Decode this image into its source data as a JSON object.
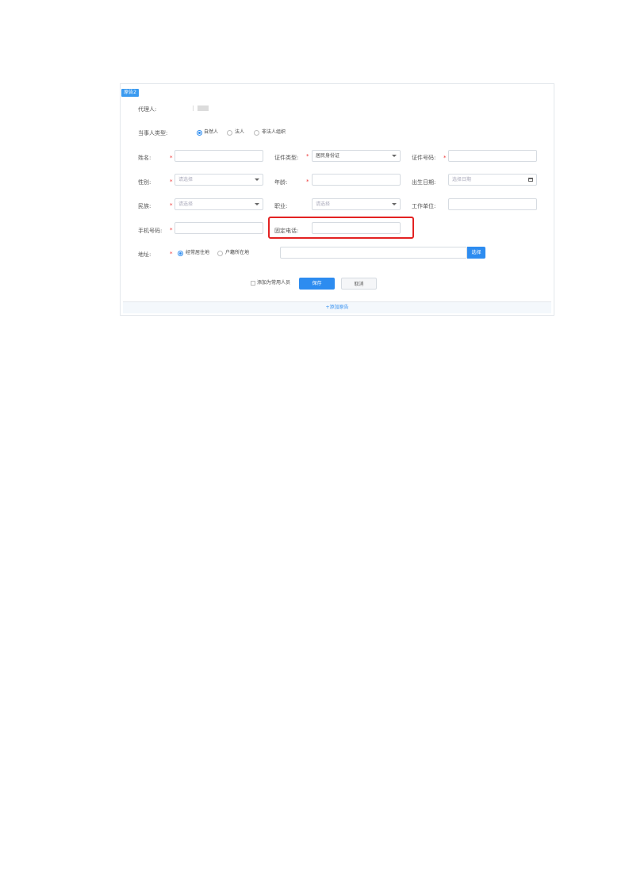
{
  "section_tag": "原告2",
  "representative": {
    "label": "代理人:"
  },
  "party_type": {
    "label": "当事人类型:",
    "options": [
      {
        "label": "自然人",
        "selected": true
      },
      {
        "label": "法人",
        "selected": false
      },
      {
        "label": "非法人组织",
        "selected": false
      }
    ]
  },
  "fields": {
    "name": {
      "label": "姓名:",
      "value": ""
    },
    "id_type": {
      "label": "证件类型:",
      "value": "居民身份证"
    },
    "id_number": {
      "label": "证件号码:",
      "value": ""
    },
    "gender": {
      "label": "性别:",
      "placeholder": "请选择"
    },
    "age": {
      "label": "年龄:",
      "value": ""
    },
    "birth_date": {
      "label": "出生日期:",
      "placeholder": "选择日期"
    },
    "ethnicity": {
      "label": "民族:",
      "placeholder": "请选择"
    },
    "occupation": {
      "label": "职业:",
      "placeholder": "请选择"
    },
    "workplace": {
      "label": "工作单位:",
      "value": ""
    },
    "mobile": {
      "label": "手机号码:",
      "value": ""
    },
    "landline": {
      "label": "固定电话:",
      "value": ""
    }
  },
  "address": {
    "label": "地址:",
    "options": [
      {
        "label": "经常居住地",
        "selected": true
      },
      {
        "label": "户籍所在地",
        "selected": false
      }
    ],
    "value": "",
    "select_button": "选择"
  },
  "actions": {
    "checkbox_label": "添加为常用人员",
    "save": "保存",
    "cancel": "取消"
  },
  "add_party_link": "+添加原告",
  "required_mark": "*",
  "colors": {
    "accent": "#2d8cf0",
    "required": "#e33333",
    "highlight": "#e32222"
  }
}
